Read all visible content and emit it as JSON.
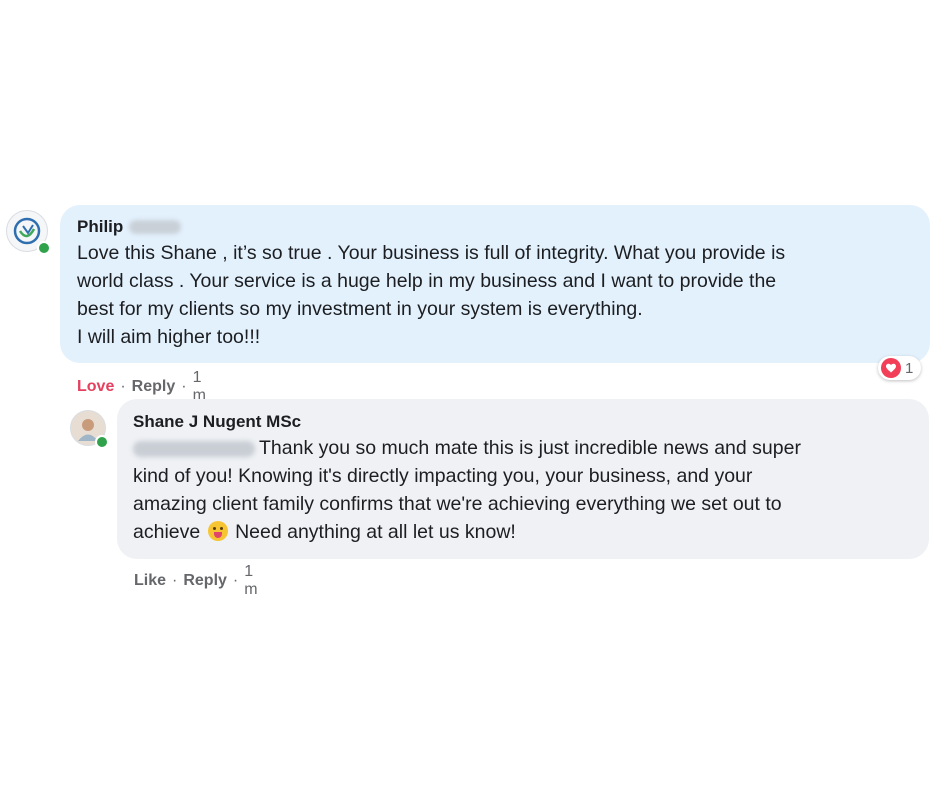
{
  "comment1": {
    "author_name": "Philip",
    "lines": [
      "Love this Shane , it’s so true . Your business is full of integrity. What you provide is",
      "world class . Your service is a huge help in my business and I want to provide the",
      "best for my clients so my investment in your system is everything.",
      "I will aim higher too!!!"
    ],
    "actions": {
      "love": "Love",
      "reply": "Reply",
      "time": "1 m",
      "separator": "·"
    },
    "reaction_count": "1",
    "reaction_icon": "heart-icon",
    "bubble_color": "#e3f1fd"
  },
  "comment2": {
    "author_name": "Shane J Nugent MSc",
    "first_line": "Thank you so much mate this is just incredible news and super",
    "lines": [
      "kind of you! Knowing it's directly impacting you, your business, and your",
      "amazing client family confirms that we're achieving everything we set out to"
    ],
    "last_line_before_emoji": "achieve",
    "last_line_after_emoji": "Need anything at all let us know!",
    "emoji_icon": "tongue-out-emoji-icon",
    "actions": {
      "like": "Like",
      "reply": "Reply",
      "time": "1 m",
      "separator": "·"
    },
    "bubble_color": "#eff1f4"
  },
  "colors": {
    "love_accent": "#e4405f",
    "online_status": "#31a24c",
    "meta_text": "#65676b"
  }
}
